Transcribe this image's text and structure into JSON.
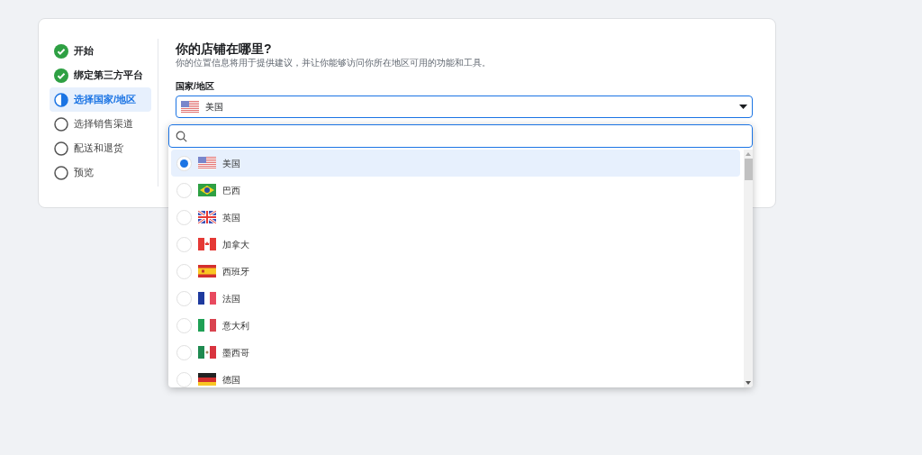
{
  "steps": [
    {
      "label": "开始",
      "kind": "done",
      "selected": false
    },
    {
      "label": "绑定第三方平台",
      "kind": "done",
      "selected": false
    },
    {
      "label": "选择国家/地区",
      "kind": "current",
      "selected": true
    },
    {
      "label": "选择销售渠道",
      "kind": "todo",
      "selected": false
    },
    {
      "label": "配送和退货",
      "kind": "todo",
      "selected": false
    },
    {
      "label": "预览",
      "kind": "todo",
      "selected": false
    }
  ],
  "heading": "你的店铺在哪里?",
  "description": "你的位置信息将用于提供建议，并让你能够访问你所在地区可用的功能和工具。",
  "field_label": "国家/地区",
  "select_value": "美国",
  "options": [
    {
      "label": "美国",
      "selected": true
    },
    {
      "label": "巴西",
      "selected": false
    },
    {
      "label": "英国",
      "selected": false
    },
    {
      "label": "加拿大",
      "selected": false
    },
    {
      "label": "西班牙",
      "selected": false
    },
    {
      "label": "法国",
      "selected": false
    },
    {
      "label": "意大利",
      "selected": false
    },
    {
      "label": "墨西哥",
      "selected": false
    },
    {
      "label": "德国",
      "selected": false
    }
  ]
}
